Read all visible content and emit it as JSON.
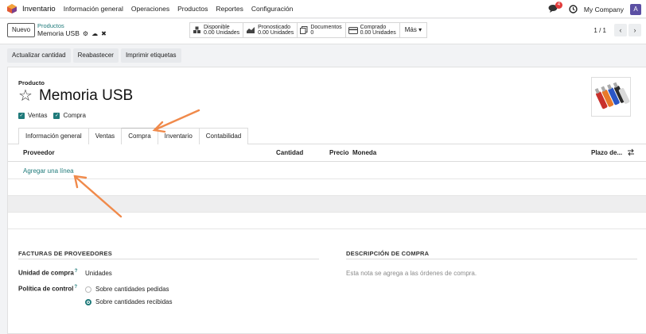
{
  "topnav": {
    "app_name": "Inventario",
    "menu": [
      "Información general",
      "Operaciones",
      "Productos",
      "Reportes",
      "Configuración"
    ],
    "chat_badge": "4",
    "company": "My Company",
    "avatar_letter": "A"
  },
  "control": {
    "new_label": "Nuevo",
    "breadcrumb_parent": "Productos",
    "breadcrumb_current": "Memoria USB",
    "stats": [
      {
        "label": "Disponible",
        "value": "0.00 Unidades"
      },
      {
        "label": "Pronosticado",
        "value": "0.00 Unidades"
      },
      {
        "label": "Documentos",
        "value": "0"
      },
      {
        "label": "Comprado",
        "value": "0.00 Unidades"
      }
    ],
    "more_label": "Más",
    "pager": "1 / 1"
  },
  "actions": [
    "Actualizar cantidad",
    "Reabastecer",
    "Imprimir etiquetas"
  ],
  "product": {
    "label": "Producto",
    "name": "Memoria USB",
    "checkboxes": [
      {
        "label": "Ventas",
        "checked": true
      },
      {
        "label": "Compra",
        "checked": true
      }
    ]
  },
  "tabs": [
    "Información general",
    "Ventas",
    "Compra",
    "Inventario",
    "Contabilidad"
  ],
  "active_tab": "Compra",
  "table": {
    "columns": [
      "Proveedor",
      "Cantidad",
      "Precio",
      "Moneda",
      "Plazo de..."
    ],
    "add_line": "Agregar una línea"
  },
  "vendor_bills": {
    "heading": "FACTURAS DE PROVEEDORES",
    "purchase_unit_label": "Unidad de compra",
    "purchase_unit_value": "Unidades",
    "control_policy_label": "Política de control",
    "options": [
      {
        "label": "Sobre cantidades pedidas",
        "selected": false
      },
      {
        "label": "Sobre cantidades recibidas",
        "selected": true
      }
    ]
  },
  "purchase_description": {
    "heading": "DESCRIPCIÓN DE COMPRA",
    "placeholder": "Esta nota se agrega a las órdenes de compra."
  },
  "colors": {
    "accent": "#1f7a7a",
    "annotation_arrow": "#f08a4b",
    "avatar": "#5b4fa3",
    "badge": "#e23b3b"
  }
}
